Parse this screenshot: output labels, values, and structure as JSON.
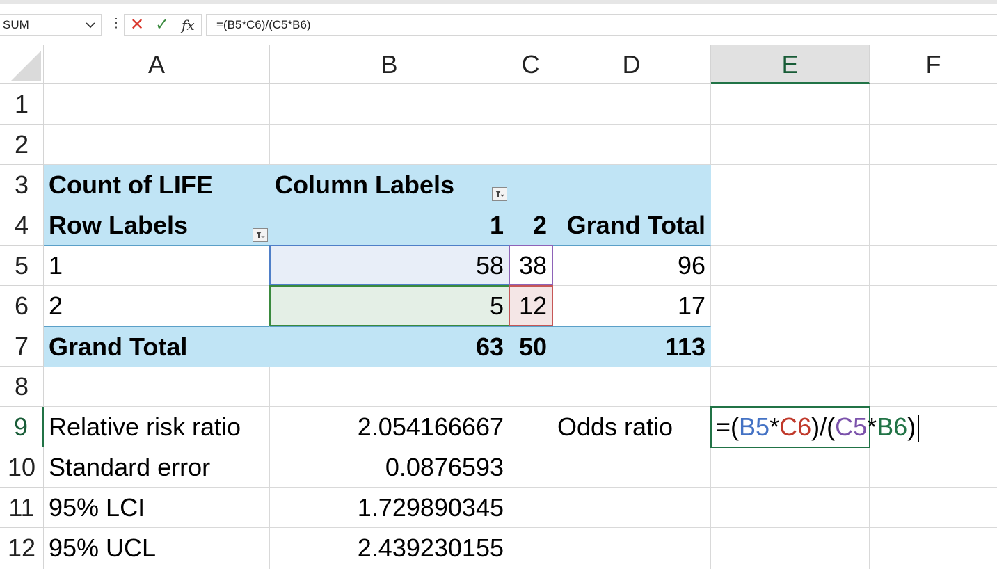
{
  "formula_bar": {
    "name_box": "SUM",
    "cancel_glyph": "✕",
    "enter_glyph": "✓",
    "fx_label": "fx",
    "formula": "=(B5*C6)/(C5*B6)"
  },
  "columns": [
    "A",
    "B",
    "C",
    "D",
    "E",
    "F"
  ],
  "rows": [
    "1",
    "2",
    "3",
    "4",
    "5",
    "6",
    "7",
    "8",
    "9",
    "10",
    "11",
    "12"
  ],
  "selected_column": "E",
  "selected_row": "9",
  "pivot": {
    "count_label": "Count of LIFE",
    "column_labels": "Column Labels",
    "row_labels": "Row Labels",
    "col_1": "1",
    "col_2": "2",
    "grand_total_header": "Grand Total",
    "row5": {
      "label": "1",
      "b": "58",
      "c": "38",
      "d": "96"
    },
    "row6": {
      "label": "2",
      "b": "5",
      "c": "12",
      "d": "17"
    },
    "total_row": {
      "label": "Grand Total",
      "b": "63",
      "c": "50",
      "d": "113"
    }
  },
  "stats": {
    "rr_label": "Relative risk ratio",
    "rr_value": "2.054166667",
    "se_label": "Standard error",
    "se_value": "0.0876593",
    "lci_label": "95% LCI",
    "lci_value": "1.729890345",
    "ucl_label": "95% UCL",
    "ucl_value": "2.439230155",
    "or_label": "Odds ratio"
  },
  "edit_cell": {
    "p1": "=(",
    "ref1": "B5",
    "op1": "*",
    "ref2": "C6",
    "p2": ")/(",
    "ref3": "C5",
    "op2": "*",
    "ref4": "B6",
    "p3": ")"
  },
  "colors": {
    "pivot_fill": "#c0e4f5",
    "accent_green": "#217346"
  }
}
